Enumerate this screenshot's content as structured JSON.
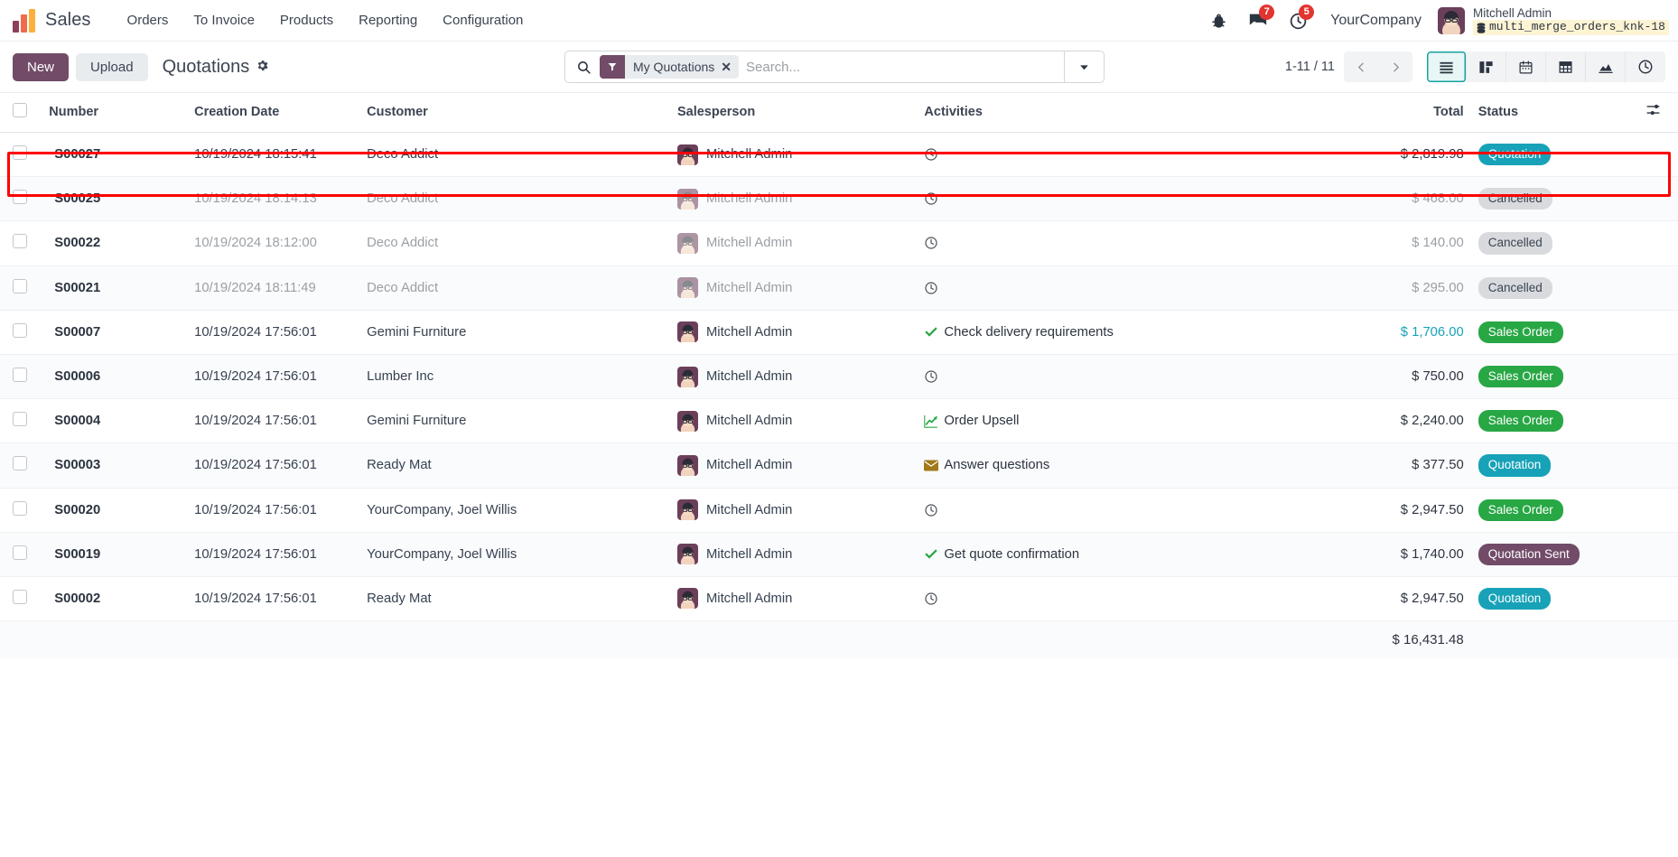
{
  "navbar": {
    "brand": "Sales",
    "menu": [
      "Orders",
      "To Invoice",
      "Products",
      "Reporting",
      "Configuration"
    ],
    "bug_icon": "bug-icon",
    "messages_icon": "messages-icon",
    "messages_count": "7",
    "activities_icon": "clock-icon",
    "activities_count": "5",
    "company": "YourCompany",
    "user_name": "Mitchell Admin",
    "database": "multi_merge_orders_knk-18",
    "database_icon": "database-icon"
  },
  "control_panel": {
    "new_label": "New",
    "upload_label": "Upload",
    "title": "Quotations",
    "gear_icon": "gear-icon",
    "search": {
      "icon": "search-icon",
      "facet_icon": "filter-icon",
      "facet_label": "My Quotations",
      "facet_remove_icon": "close-icon",
      "placeholder": "Search...",
      "dropdown_icon": "chevron-down-icon"
    },
    "pager": {
      "range": "1-11 / 11",
      "prev_icon": "chevron-left-icon",
      "next_icon": "chevron-right-icon"
    },
    "views": [
      {
        "name": "list",
        "icon": "list-icon",
        "active": true
      },
      {
        "name": "kanban",
        "icon": "kanban-icon",
        "active": false
      },
      {
        "name": "calendar",
        "icon": "calendar-icon",
        "active": false
      },
      {
        "name": "pivot",
        "icon": "pivot-icon",
        "active": false
      },
      {
        "name": "graph",
        "icon": "graph-icon",
        "active": false
      },
      {
        "name": "activity",
        "icon": "activity-clock-icon",
        "active": false
      }
    ]
  },
  "table": {
    "columns": {
      "number": "Number",
      "creation_date": "Creation Date",
      "customer": "Customer",
      "salesperson": "Salesperson",
      "activities": "Activities",
      "total": "Total",
      "status": "Status",
      "options_icon": "column-options-icon"
    },
    "rows": [
      {
        "number": "S00027",
        "date": "10/19/2024 18:15:41",
        "customer": "Deco Addict",
        "salesperson": "Mitchell Admin",
        "activity_icon": "clock-icon",
        "activity_text": "",
        "total": "$ 2,819.98",
        "status": "Quotation",
        "status_class": "b-quotation",
        "dimmed": false,
        "total_blue": false,
        "highlighted": true
      },
      {
        "number": "S00025",
        "date": "10/19/2024 18:14:13",
        "customer": "Deco Addict",
        "salesperson": "Mitchell Admin",
        "activity_icon": "clock-icon",
        "activity_text": "",
        "total": "$ 468.00",
        "status": "Cancelled",
        "status_class": "b-cancelled",
        "dimmed": true,
        "total_blue": false,
        "highlighted": false
      },
      {
        "number": "S00022",
        "date": "10/19/2024 18:12:00",
        "customer": "Deco Addict",
        "salesperson": "Mitchell Admin",
        "activity_icon": "clock-icon",
        "activity_text": "",
        "total": "$ 140.00",
        "status": "Cancelled",
        "status_class": "b-cancelled",
        "dimmed": true,
        "total_blue": false,
        "highlighted": false
      },
      {
        "number": "S00021",
        "date": "10/19/2024 18:11:49",
        "customer": "Deco Addict",
        "salesperson": "Mitchell Admin",
        "activity_icon": "clock-icon",
        "activity_text": "",
        "total": "$ 295.00",
        "status": "Cancelled",
        "status_class": "b-cancelled",
        "dimmed": true,
        "total_blue": false,
        "highlighted": false
      },
      {
        "number": "S00007",
        "date": "10/19/2024 17:56:01",
        "customer": "Gemini Furniture",
        "salesperson": "Mitchell Admin",
        "activity_icon": "check-icon",
        "activity_text": "Check delivery requirements",
        "total": "$ 1,706.00",
        "status": "Sales Order",
        "status_class": "b-sales-order",
        "dimmed": false,
        "total_blue": true,
        "highlighted": false
      },
      {
        "number": "S00006",
        "date": "10/19/2024 17:56:01",
        "customer": "Lumber Inc",
        "salesperson": "Mitchell Admin",
        "activity_icon": "clock-icon",
        "activity_text": "",
        "total": "$ 750.00",
        "status": "Sales Order",
        "status_class": "b-sales-order",
        "dimmed": false,
        "total_blue": false,
        "highlighted": false
      },
      {
        "number": "S00004",
        "date": "10/19/2024 17:56:01",
        "customer": "Gemini Furniture",
        "salesperson": "Mitchell Admin",
        "activity_icon": "upsell-chart-icon",
        "activity_text": "Order Upsell",
        "total": "$ 2,240.00",
        "status": "Sales Order",
        "status_class": "b-sales-order",
        "dimmed": false,
        "total_blue": false,
        "highlighted": false
      },
      {
        "number": "S00003",
        "date": "10/19/2024 17:56:01",
        "customer": "Ready Mat",
        "salesperson": "Mitchell Admin",
        "activity_icon": "email-icon",
        "activity_text": "Answer questions",
        "total": "$ 377.50",
        "status": "Quotation",
        "status_class": "b-quotation",
        "dimmed": false,
        "total_blue": false,
        "highlighted": false
      },
      {
        "number": "S00020",
        "date": "10/19/2024 17:56:01",
        "customer": "YourCompany, Joel Willis",
        "salesperson": "Mitchell Admin",
        "activity_icon": "clock-icon",
        "activity_text": "",
        "total": "$ 2,947.50",
        "status": "Sales Order",
        "status_class": "b-sales-order",
        "dimmed": false,
        "total_blue": false,
        "highlighted": false
      },
      {
        "number": "S00019",
        "date": "10/19/2024 17:56:01",
        "customer": "YourCompany, Joel Willis",
        "salesperson": "Mitchell Admin",
        "activity_icon": "check-icon",
        "activity_text": "Get quote confirmation",
        "total": "$ 1,740.00",
        "status": "Quotation Sent",
        "status_class": "b-quotation-sent",
        "dimmed": false,
        "total_blue": false,
        "highlighted": false
      },
      {
        "number": "S00002",
        "date": "10/19/2024 17:56:01",
        "customer": "Ready Mat",
        "salesperson": "Mitchell Admin",
        "activity_icon": "clock-icon",
        "activity_text": "",
        "total": "$ 2,947.50",
        "status": "Quotation",
        "status_class": "b-quotation",
        "dimmed": false,
        "total_blue": false,
        "highlighted": false
      }
    ],
    "grand_total": "$ 16,431.48"
  }
}
